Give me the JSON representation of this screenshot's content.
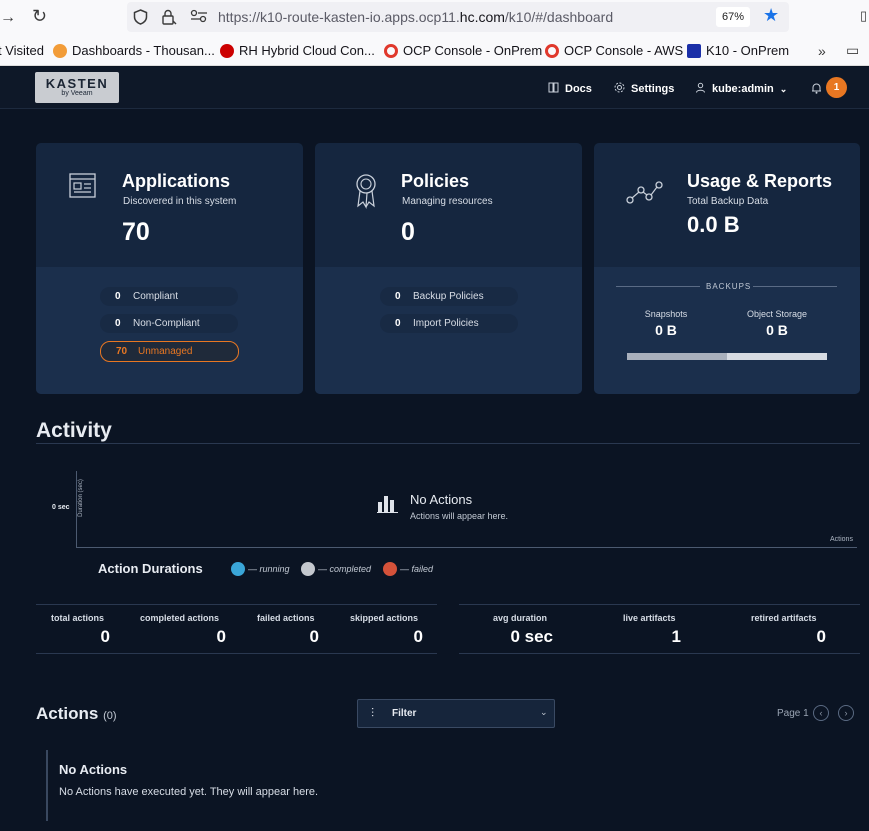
{
  "browser": {
    "url_prefix": "https://k10-route-kasten-io.apps.ocp11.",
    "url_domain": "hc.com",
    "url_suffix": "/k10/#/dashboard",
    "zoom": "67%",
    "bookmarks": [
      {
        "label": "t Visited"
      },
      {
        "label": "Dashboards - Thousan..."
      },
      {
        "label": "RH Hybrid Cloud Con..."
      },
      {
        "label": "OCP Console - OnPrem"
      },
      {
        "label": "OCP Console - AWS"
      },
      {
        "label": "K10 - OnPrem"
      }
    ]
  },
  "header": {
    "logo_main": "KASTEN",
    "logo_sub": "by Veeam",
    "docs": "Docs",
    "settings": "Settings",
    "user": "kube:admin",
    "notifications": "1"
  },
  "cards": {
    "applications": {
      "title": "Applications",
      "subtitle": "Discovered in this system",
      "count": "70",
      "rows": [
        {
          "num": "0",
          "label": "Compliant"
        },
        {
          "num": "0",
          "label": "Non-Compliant"
        },
        {
          "num": "70",
          "label": "Unmanaged"
        }
      ]
    },
    "policies": {
      "title": "Policies",
      "subtitle": "Managing resources",
      "count": "0",
      "rows": [
        {
          "num": "0",
          "label": "Backup Policies"
        },
        {
          "num": "0",
          "label": "Import Policies"
        }
      ]
    },
    "usage": {
      "title": "Usage & Reports",
      "subtitle": "Total Backup Data",
      "value": "0.0 B",
      "backups_label": "BACKUPS",
      "snapshots_label": "Snapshots",
      "snapshots_value": "0 B",
      "object_label": "Object Storage",
      "object_value": "0 B"
    }
  },
  "activity": {
    "title": "Activity",
    "y_tick": "0 sec",
    "y_axis_label": "Duration (sec)",
    "x_axis_label": "Actions",
    "empty_title": "No Actions",
    "empty_sub": "Actions will appear here.",
    "legend_title": "Action Durations",
    "legend": [
      {
        "label": "— running",
        "color": "#3aa6d8"
      },
      {
        "label": "— completed",
        "color": "#c4c8ce"
      },
      {
        "label": "— failed",
        "color": "#d5523a"
      }
    ],
    "stats": [
      {
        "label": "total actions",
        "value": "0"
      },
      {
        "label": "completed actions",
        "value": "0"
      },
      {
        "label": "failed actions",
        "value": "0"
      },
      {
        "label": "skipped actions",
        "value": "0"
      },
      {
        "label": "avg duration",
        "value": "0 sec"
      },
      {
        "label": "live artifacts",
        "value": "1"
      },
      {
        "label": "retired artifacts",
        "value": "0"
      }
    ]
  },
  "actions": {
    "title": "Actions",
    "count": "(0)",
    "filter_label": "Filter",
    "page_label": "Page 1",
    "empty_title": "No Actions",
    "empty_sub": "No Actions have executed yet. They will appear here."
  },
  "colors": {
    "accent": "#e87722",
    "card": "#15263f",
    "background": "#0b1423"
  }
}
